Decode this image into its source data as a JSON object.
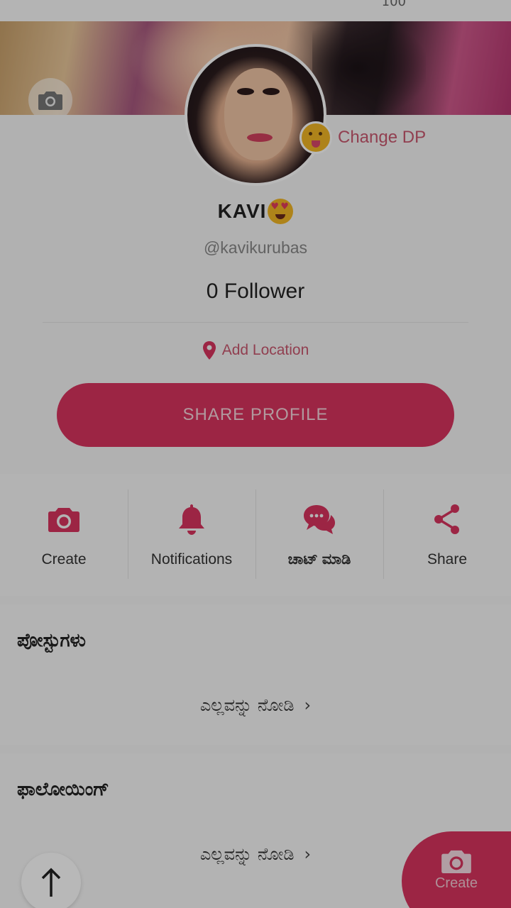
{
  "top": {
    "count": "100"
  },
  "cover": {
    "camera_icon": "camera-icon"
  },
  "profile": {
    "change_dp_label": "Change DP",
    "name": "KAVI",
    "handle": "@kavikurubas",
    "followers": "0 Follower",
    "location_label": "Add Location",
    "share_button": "SHARE PROFILE"
  },
  "actions": [
    {
      "label": "Create",
      "icon": "camera-icon"
    },
    {
      "label": "Notifications",
      "icon": "bell-icon"
    },
    {
      "label": "ಚಾಟ್ ಮಾಡಿ",
      "icon": "chat-bubbles-icon"
    },
    {
      "label": "Share",
      "icon": "share-icon"
    }
  ],
  "sections": {
    "posts": {
      "title": "ಪೋಸ್ಟುಗಳು",
      "see_all": "ಎಲ್ಲವನ್ನು ನೋಡಿ"
    },
    "following": {
      "title": "ಫಾಲೋಯಿಂಗ್",
      "see_all": "ಎಲ್ಲವನ್ನು ನೋಡಿ"
    }
  },
  "fab": {
    "label": "Create"
  },
  "colors": {
    "accent": "#d9345f",
    "accent_text": "#c9586f",
    "overlay": "rgba(0,0,0,0.28)"
  }
}
